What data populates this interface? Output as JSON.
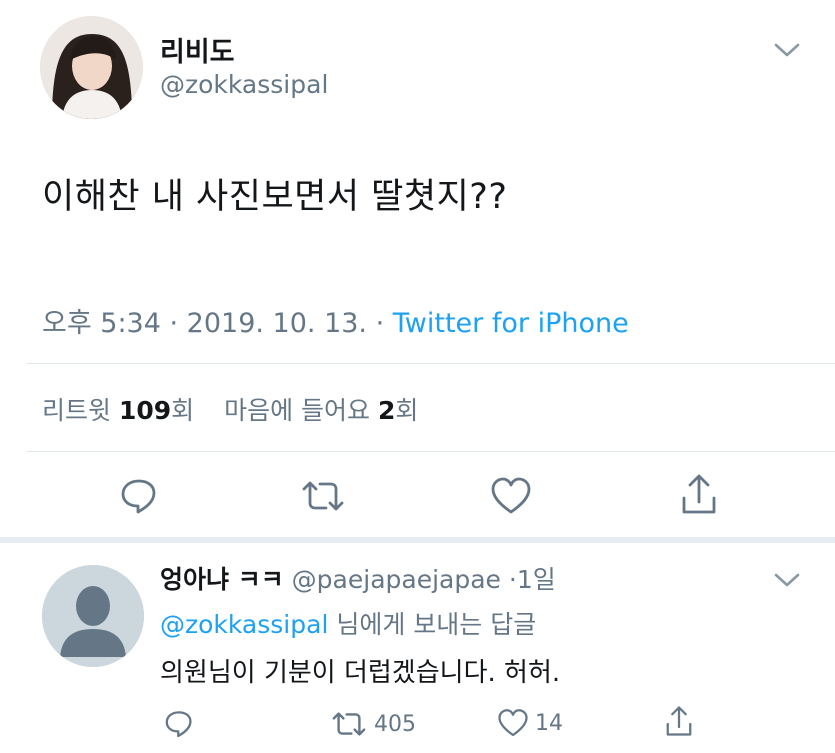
{
  "tweet": {
    "display_name": "리비도",
    "handle": "@zokkassipal",
    "text": "이해찬 내 사진보면서 딸쳣지??",
    "time": "오후 5:34",
    "date": "2019. 10. 13.",
    "source": "Twitter for iPhone",
    "retweets_label": "리트윗",
    "retweets_count": "109",
    "retweets_unit": "회",
    "likes_label": "마음에 들어요",
    "likes_count": "2",
    "likes_unit": "회"
  },
  "reply": {
    "display_name": "엉아냐 ㅋㅋ",
    "handle": "@paejapaejapae",
    "age": "1일",
    "replying_to_handle": "@zokkassipal",
    "replying_to_suffix": "님에게 보내는 답글",
    "text": "의원님이 기분이 더럽겠습니다. 허허.",
    "retweet_count": "405",
    "like_count": "14"
  },
  "icons": {
    "chevron": "chevron-down-icon",
    "reply": "reply-icon",
    "retweet": "retweet-icon",
    "like": "heart-icon",
    "share": "share-icon"
  },
  "colors": {
    "link": "#1da1f2",
    "secondary_text": "#657786",
    "primary_text": "#14171a",
    "divider": "#e1e8ed"
  }
}
